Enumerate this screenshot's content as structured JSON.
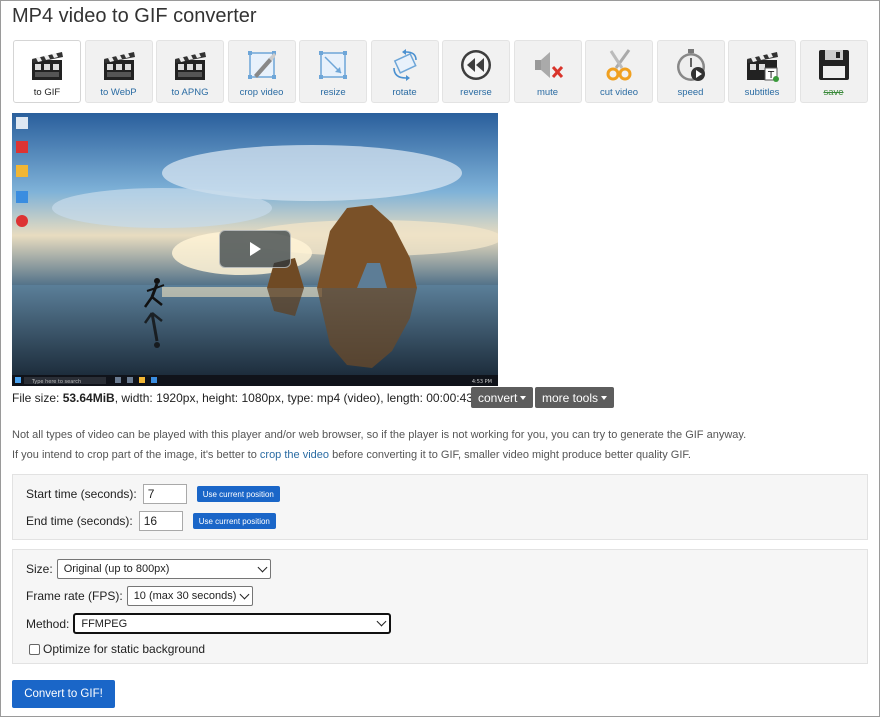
{
  "page": {
    "title": "MP4 video to GIF converter"
  },
  "toolbar": {
    "items": [
      {
        "label": "to GIF",
        "icon": "clapperboard-icon",
        "active": true
      },
      {
        "label": "to WebP",
        "icon": "clapperboard-icon"
      },
      {
        "label": "to APNG",
        "icon": "clapperboard-icon"
      },
      {
        "label": "crop video",
        "icon": "crop-icon"
      },
      {
        "label": "resize",
        "icon": "resize-icon"
      },
      {
        "label": "rotate",
        "icon": "rotate-icon"
      },
      {
        "label": "reverse",
        "icon": "rewind-icon"
      },
      {
        "label": "mute",
        "icon": "mute-icon"
      },
      {
        "label": "cut video",
        "icon": "scissors-icon"
      },
      {
        "label": "speed",
        "icon": "stopwatch-icon"
      },
      {
        "label": "subtitles",
        "icon": "subtitles-icon"
      },
      {
        "label": "save",
        "icon": "floppy-disk-icon",
        "strikethrough": true
      }
    ]
  },
  "video": {
    "taskbar_search_placeholder": "Type here to search",
    "clock_time": "4:53 PM"
  },
  "file_info": {
    "prefix": "File size: ",
    "size": "53.64MiB",
    "rest": ", width: 1920px, height: 1080px, type: mp4 (video), length: 00:00:43"
  },
  "buttons": {
    "convert": "convert",
    "more_tools": "more tools",
    "submit": "Convert to GIF!"
  },
  "notes": {
    "line1": "Not all types of video can be played with this player and/or web browser, so if the player is not working for you, you can try to generate the GIF anyway.",
    "line2_before": "If you intend to crop part of the image, it's better to ",
    "line2_link": "crop the video",
    "line2_after": " before converting it to GIF, smaller video might produce better quality GIF."
  },
  "time": {
    "start_label": "Start time (seconds):",
    "start_value": "7",
    "end_label": "End time (seconds):",
    "end_value": "16",
    "use_current": "Use current position"
  },
  "options": {
    "size_label": "Size:",
    "size_value": "Original (up to 800px)",
    "fps_label": "Frame rate (FPS):",
    "fps_value": "10 (max 30 seconds)",
    "method_label": "Method:",
    "method_value": "FFMPEG",
    "optimize_label": "Optimize for static background",
    "optimize_checked": false
  },
  "colors": {
    "primary": "#1a66c8",
    "link": "#2b6ca3",
    "dark_button": "#5d5d5d"
  }
}
